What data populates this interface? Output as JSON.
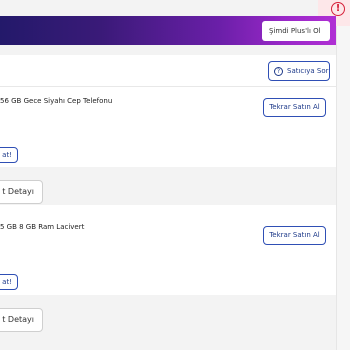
{
  "notification": {
    "icon": "alert-circle-icon",
    "symbol": "!"
  },
  "banner": {
    "plus_button_label": "Şimdi Plus'lı Ol"
  },
  "seller": {
    "ask_button_label": "Satıcıya Sor",
    "ask_icon": "question-circle-icon",
    "ask_symbol": "?"
  },
  "orders": [
    {
      "product_name": "56 GB Gece Siyahı Cep Telefonu",
      "rebuy_label": "Tekrar Satın Al",
      "rate_label": "at!",
      "detail_label": "t Detayı"
    },
    {
      "product_name": "5 GB 8 GB Ram Lacivert",
      "rebuy_label": "Tekrar Satın Al",
      "rate_label": "at!",
      "detail_label": "t Detayı"
    }
  ],
  "colors": {
    "banner_gradient_start": "#23196a",
    "banner_gradient_end": "#b02fd4",
    "accent_blue": "#1e3a8a",
    "alert_red": "#d6213a"
  }
}
